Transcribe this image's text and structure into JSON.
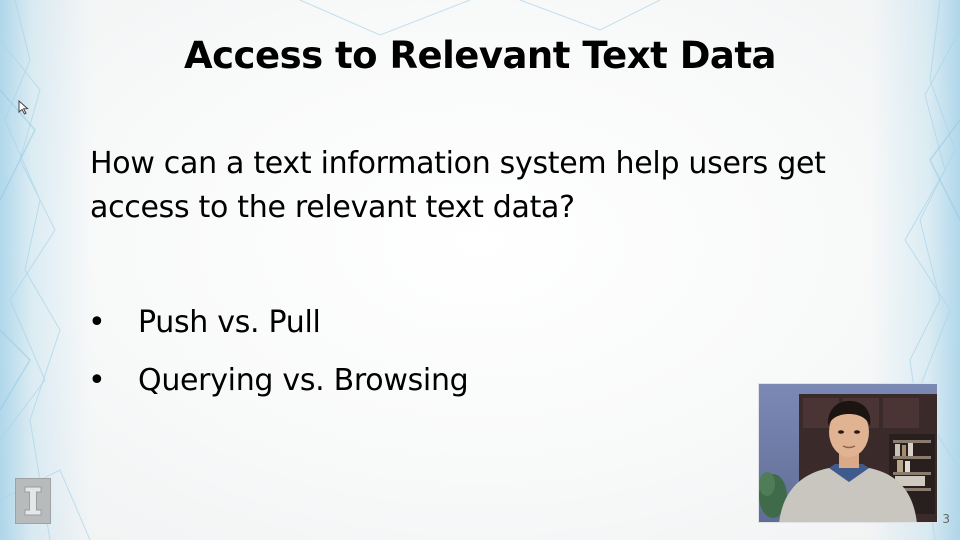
{
  "slide": {
    "title": "Access to Relevant Text Data",
    "question": "How can a text information system help users get access to the relevant text data?",
    "bullets": [
      {
        "marker": "•",
        "text": "Push vs. Pull"
      },
      {
        "marker": "•",
        "text": "Querying vs. Browsing"
      }
    ],
    "page_number": "3"
  },
  "icons": {
    "cursor": "mouse-pointer-icon",
    "logo": "university-block-i-logo",
    "video": "presenter-webcam-video"
  },
  "colors": {
    "accent": "#7fc3e4",
    "text": "#000000",
    "background": "#f7f8f8"
  }
}
